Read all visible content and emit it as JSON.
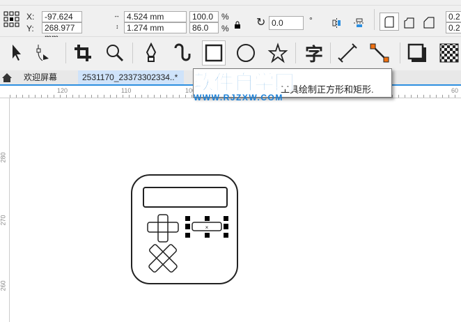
{
  "property_bar": {
    "x_label": "X:",
    "y_label": "Y:",
    "x_value": "-97.624 mm",
    "y_value": "268.977 mm",
    "width_value": "4.524 mm",
    "height_value": "1.274 mm",
    "scale_x": "100.0",
    "scale_y": "86.0",
    "percent": "%",
    "rotation": "0.0",
    "degree": "°",
    "corner_partial_1": "0.2",
    "corner_partial_2": "0.2"
  },
  "toolbox": {
    "text_tool_glyph": "字"
  },
  "tabs": [
    {
      "label": "欢迎屏幕"
    },
    {
      "label": "2531170_23373302334..*"
    }
  ],
  "ruler": {
    "h_labels": [
      "120",
      "110",
      "100",
      "60"
    ],
    "v_labels": [
      "280",
      "270",
      "260"
    ]
  },
  "tooltip": {
    "text": "工具绘制正方形和矩形."
  },
  "watermark": {
    "title": "软件自学网",
    "url": "WWW.RJZXW.COM"
  },
  "colors": {
    "accent": "#2c8fe0",
    "handle": "#000000",
    "orange": "#f07010"
  }
}
